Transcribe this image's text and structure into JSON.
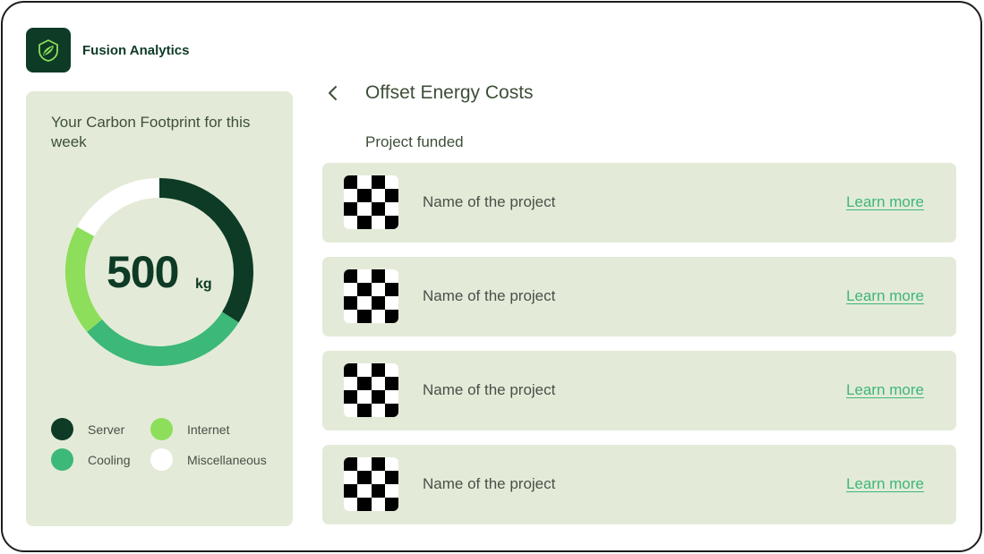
{
  "app": {
    "name": "Fusion Analytics",
    "logo_icon": "leaf-icon",
    "brand_color": "#0d3b26"
  },
  "footprint": {
    "title": "Your Carbon Footprint for this week",
    "value": "500",
    "unit": "kg",
    "segments": [
      {
        "name": "Server",
        "share": 0.34,
        "color": "#0d3b26"
      },
      {
        "name": "Cooling",
        "share": 0.3,
        "color": "#3cb878"
      },
      {
        "name": "Internet",
        "share": 0.19,
        "color": "#8dde5a"
      },
      {
        "name": "Miscellaneous",
        "share": 0.17,
        "color": "#ffffff"
      }
    ],
    "legend": [
      {
        "label": "Server",
        "color": "#0d3b26"
      },
      {
        "label": "Internet",
        "color": "#8dde5a"
      },
      {
        "label": "Cooling",
        "color": "#3cb878"
      },
      {
        "label": "Miscellaneous",
        "color": "#ffffff"
      }
    ]
  },
  "header": {
    "back_icon": "chevron-left-icon",
    "title": "Offset Energy Costs"
  },
  "section": {
    "label": "Project funded"
  },
  "projects": [
    {
      "name": "Name of the project",
      "link": "Learn more",
      "thumb_icon": "checkerboard-placeholder-icon"
    },
    {
      "name": "Name of the project",
      "link": "Learn more",
      "thumb_icon": "checkerboard-placeholder-icon"
    },
    {
      "name": "Name of the project",
      "link": "Learn more",
      "thumb_icon": "checkerboard-placeholder-icon"
    },
    {
      "name": "Name of the project",
      "link": "Learn more",
      "thumb_icon": "checkerboard-placeholder-icon"
    }
  ],
  "colors": {
    "panel": "#e3ebd8",
    "link": "#3fb57a",
    "text": "#3e4f38"
  }
}
